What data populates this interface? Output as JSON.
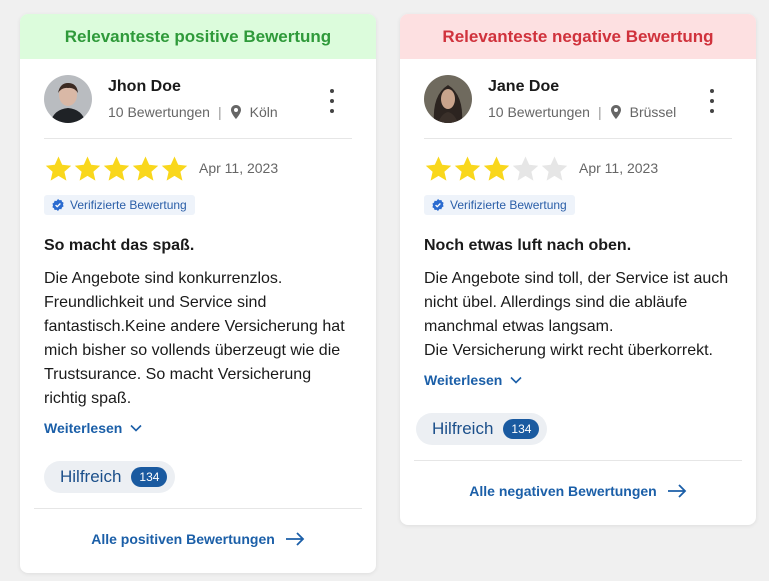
{
  "cards": [
    {
      "header": "Relevanteste positive Bewertung",
      "header_color": "#2f9a3a",
      "header_bg": "#dcfcdc",
      "reviewer": {
        "name": "Jhon Doe",
        "reviews_count": "10 Bewertungen",
        "separator": "|",
        "location": "Köln"
      },
      "rating": 5,
      "max_rating": 5,
      "date": "Apr 11, 2023",
      "verified_label": "Verifizierte Bewertung",
      "title": "So macht das spaß.",
      "body": "Die Angebote sind konkurrenzlos. Freundlichkeit und Service sind fantastisch.Keine andere Versicherung hat mich bisher so vollends überzeugt wie die Trustsurance. So macht Versicherung richtig spaß.",
      "read_more": "Weiterlesen",
      "helpful_label": "Hilfreich",
      "helpful_count": "134",
      "all_link": "Alle positiven Bewertungen"
    },
    {
      "header": "Relevanteste negative Bewertung",
      "header_color": "#d0323c",
      "header_bg": "#fde0e1",
      "reviewer": {
        "name": "Jane Doe",
        "reviews_count": "10 Bewertungen",
        "separator": "|",
        "location": "Brüssel"
      },
      "rating": 3,
      "max_rating": 5,
      "date": "Apr 11, 2023",
      "verified_label": "Verifizierte Bewertung",
      "title": "Noch etwas luft nach oben.",
      "body": "Die Angebote sind toll, der Service ist auch nicht übel. Allerdings sind die abläufe manchmal etwas langsam.\nDie Versicherung wirkt recht überkorrekt.",
      "read_more": "Weiterlesen",
      "helpful_label": "Hilfreich",
      "helpful_count": "134",
      "all_link": "Alle negativen Bewertungen"
    }
  ],
  "colors": {
    "star_filled": "#f9d71c",
    "star_empty": "#e6e6e6",
    "link": "#1b5fa8",
    "badge": "#1a5aa0"
  }
}
